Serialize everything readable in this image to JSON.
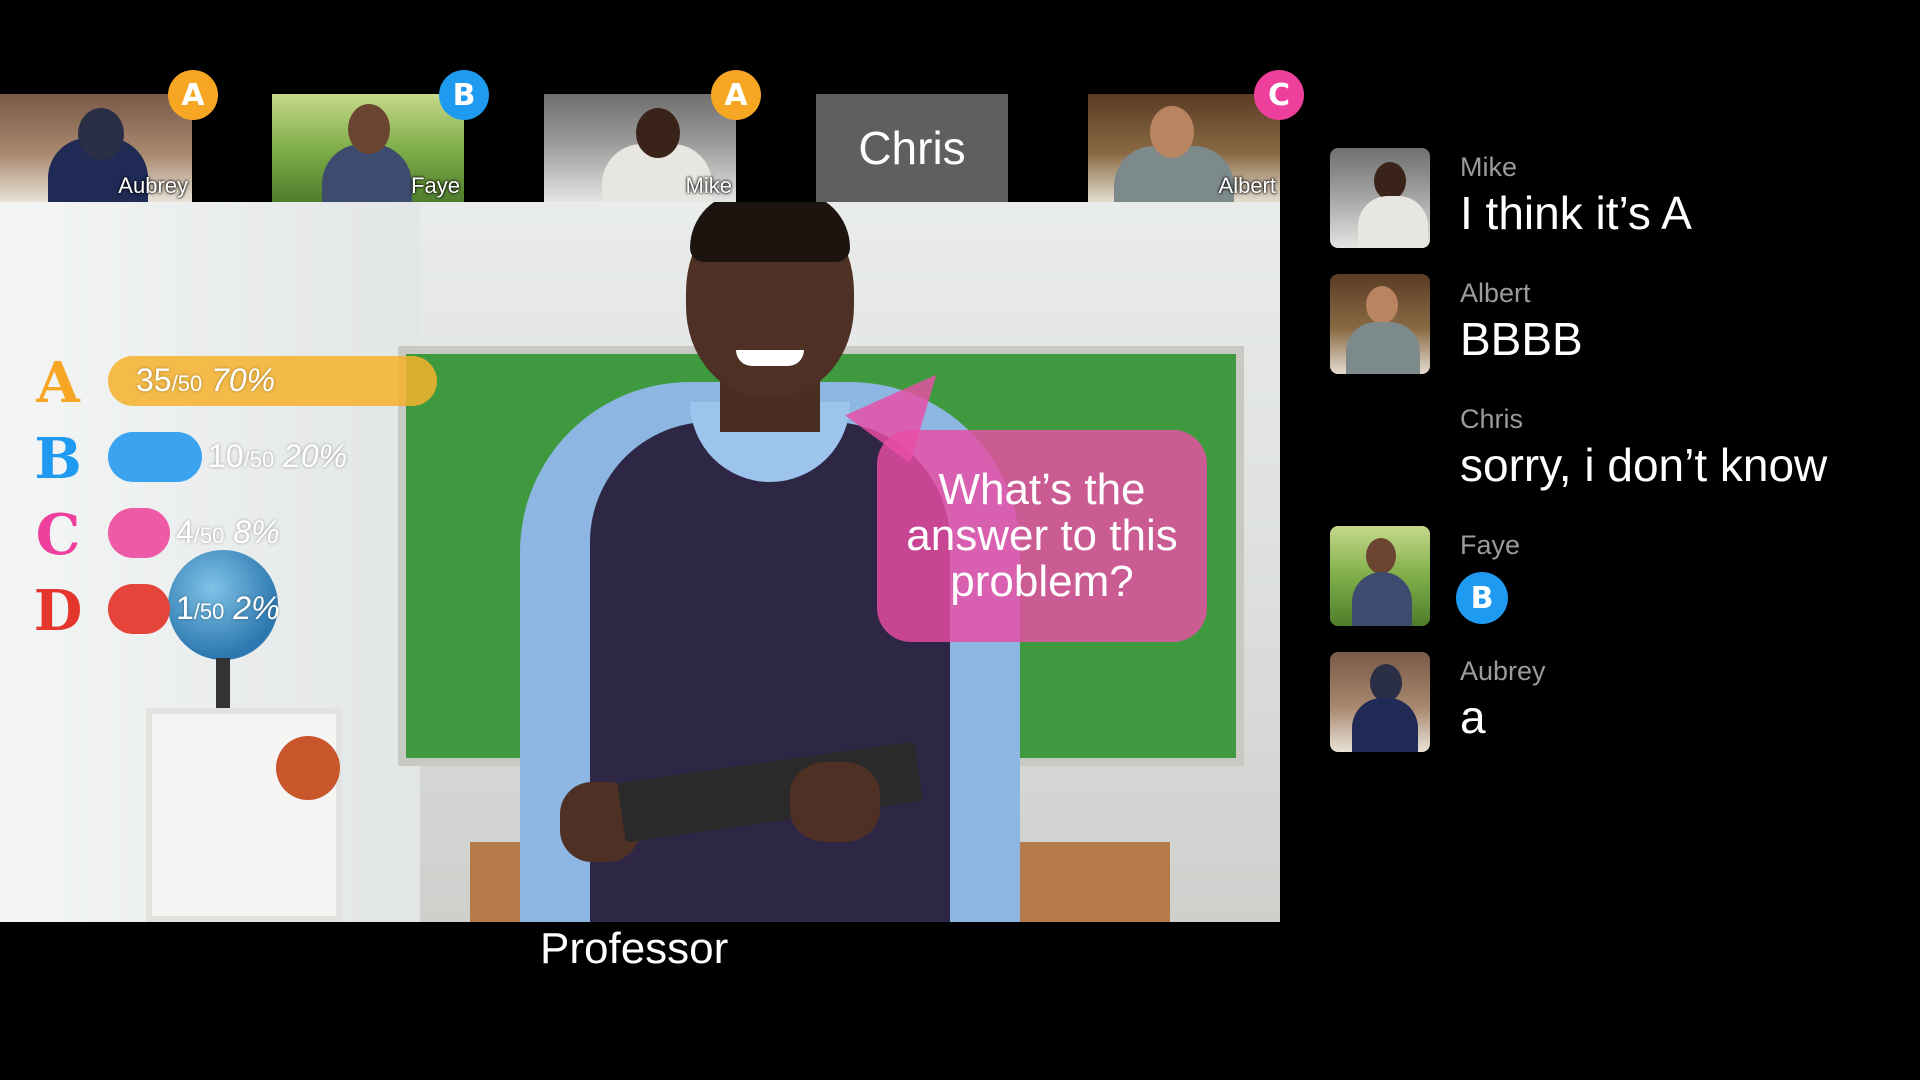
{
  "participants": [
    {
      "name": "Aubrey",
      "answer": "A",
      "badge_color": "#f6a623"
    },
    {
      "name": "Faye",
      "answer": "B",
      "badge_color": "#1e9bf0"
    },
    {
      "name": "Mike",
      "answer": "A",
      "badge_color": "#f6a623"
    },
    {
      "name": "Chris",
      "answer": "",
      "badge_color": ""
    },
    {
      "name": "Albert",
      "answer": "C",
      "badge_color": "#ee3f9c"
    }
  ],
  "stage": {
    "speaker_label": "Professor",
    "question": "What’s the answer to this problem?"
  },
  "poll": {
    "total": 50,
    "options": [
      {
        "letter": "A",
        "count": "35",
        "den": "/50",
        "percent": "70%",
        "fraction": 0.7,
        "color": "#f6b22c"
      },
      {
        "letter": "B",
        "count": "10",
        "den": "/50",
        "percent": "20%",
        "fraction": 0.2,
        "color": "#3ba3ef"
      },
      {
        "letter": "C",
        "count": "4",
        "den": "/50",
        "percent": "8%",
        "fraction": 0.08,
        "color": "#ef5aa6"
      },
      {
        "letter": "D",
        "count": "1",
        "den": "/50",
        "percent": "2%",
        "fraction": 0.02,
        "color": "#e5443b"
      }
    ]
  },
  "chat": [
    {
      "sender": "Mike",
      "text": "I think it’s A",
      "has_avatar": true
    },
    {
      "sender": "Albert",
      "text": "BBBB",
      "has_avatar": true
    },
    {
      "sender": "Chris",
      "text": "sorry, i don’t know",
      "has_avatar": false
    },
    {
      "sender": "Faye",
      "text": "",
      "answer_chip": "B",
      "has_avatar": true
    },
    {
      "sender": "Aubrey",
      "text": "a",
      "has_avatar": true
    }
  ]
}
